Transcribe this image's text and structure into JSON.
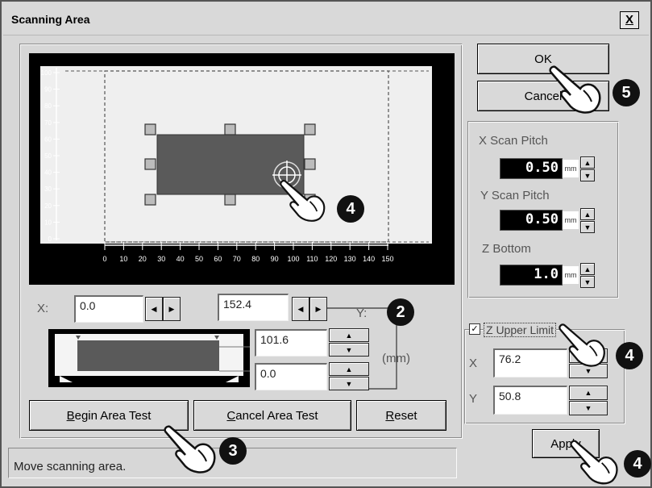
{
  "window": {
    "title": "Scanning Area",
    "close_label": "X"
  },
  "preview": {
    "y_ticks": [
      "100",
      "90",
      "80",
      "70",
      "60",
      "50",
      "40",
      "30",
      "20",
      "10",
      "0"
    ],
    "x_ticks": [
      "0",
      "10",
      "20",
      "30",
      "40",
      "50",
      "60",
      "70",
      "80",
      "90",
      "100",
      "110",
      "120",
      "130",
      "140",
      "150"
    ]
  },
  "coords": {
    "x_label": "X:",
    "x_min": "0.0",
    "x_max": "152.4",
    "y_label": "Y:",
    "y_max": "101.6",
    "y_min": "0.0",
    "unit_label": "(mm)"
  },
  "buttons": {
    "begin_prefix": "B",
    "begin_rest": "egin Area Test",
    "cancel_test_prefix": "C",
    "cancel_test_rest": "ancel Area Test",
    "reset_prefix": "R",
    "reset_rest": "eset",
    "ok": "OK",
    "cancel": "Cancel",
    "apply": "Apply"
  },
  "status": {
    "message": "Move scanning area."
  },
  "scan": {
    "x_pitch_label": "X Scan Pitch",
    "x_pitch_value": "0.50",
    "y_pitch_label": "Y Scan Pitch",
    "y_pitch_value": "0.50",
    "z_bottom_label": "Z Bottom",
    "z_bottom_value": "1.0",
    "unit": "mm"
  },
  "z_upper": {
    "checkbox_mark": "✓",
    "label": "Z Upper Limit",
    "x_label": "X",
    "x_value": "76.2",
    "y_label": "Y",
    "y_value": "50.8"
  },
  "markers": {
    "two": "2",
    "three": "3",
    "four": "4",
    "five": "5"
  },
  "icons": {
    "pointer": "hand-pointer-icon",
    "crosshair": "crosshair-icon"
  }
}
